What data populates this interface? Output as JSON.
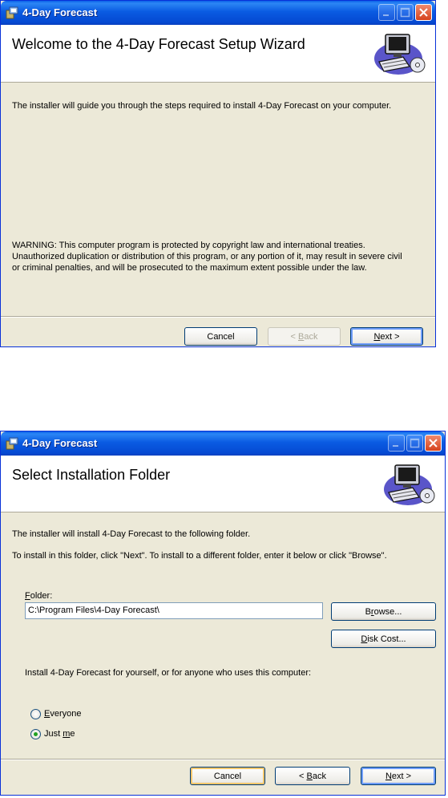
{
  "window1": {
    "title": "4-Day Forecast",
    "header_title": "Welcome to the 4-Day Forecast Setup Wizard",
    "intro": "The installer will guide you through the steps required to install 4-Day Forecast on your computer.",
    "warning_line1": "WARNING: This computer program is protected by copyright law and international treaties.",
    "warning_line2": "Unauthorized duplication or distribution of this program, or any portion of it, may result in severe civil",
    "warning_line3": "or criminal penalties, and will be prosecuted to the maximum extent possible under the law.",
    "cancel_label": "Cancel",
    "back_prefix": "< ",
    "back_key": "B",
    "back_rest": "ack",
    "next_key": "N",
    "next_rest": "ext >"
  },
  "window2": {
    "title": "4-Day Forecast",
    "header_title": "Select Installation Folder",
    "line1": "The installer will install 4-Day Forecast to the following folder.",
    "line2": "To install in this folder, click \"Next\". To install to a different folder, enter it below or click \"Browse\".",
    "folder_key": "F",
    "folder_rest": "older:",
    "folder_value": "C:\\Program Files\\4-Day Forecast\\",
    "browse_pre": "B",
    "browse_key": "r",
    "browse_rest": "owse...",
    "diskcost_key": "D",
    "diskcost_rest": "isk Cost...",
    "install_for": "Install 4-Day Forecast for yourself, or for anyone who uses this computer:",
    "everyone_key": "E",
    "everyone_rest": "veryone",
    "justme_pre": "Just ",
    "justme_key": "m",
    "justme_rest": "e",
    "selected_option": "Just me",
    "cancel_label": "Cancel",
    "back_prefix": "< ",
    "back_key": "B",
    "back_rest": "ack",
    "next_key": "N",
    "next_rest": "ext >"
  },
  "icons": [
    "setup-app-icon",
    "minimize-icon",
    "maximize-icon",
    "close-icon",
    "computer-cd-graphic"
  ],
  "colors": {
    "titlebar": "#0a5be2",
    "dialog_bg": "#ece9d8",
    "close_button": "#d6431e",
    "radio_dot": "#21a121"
  }
}
